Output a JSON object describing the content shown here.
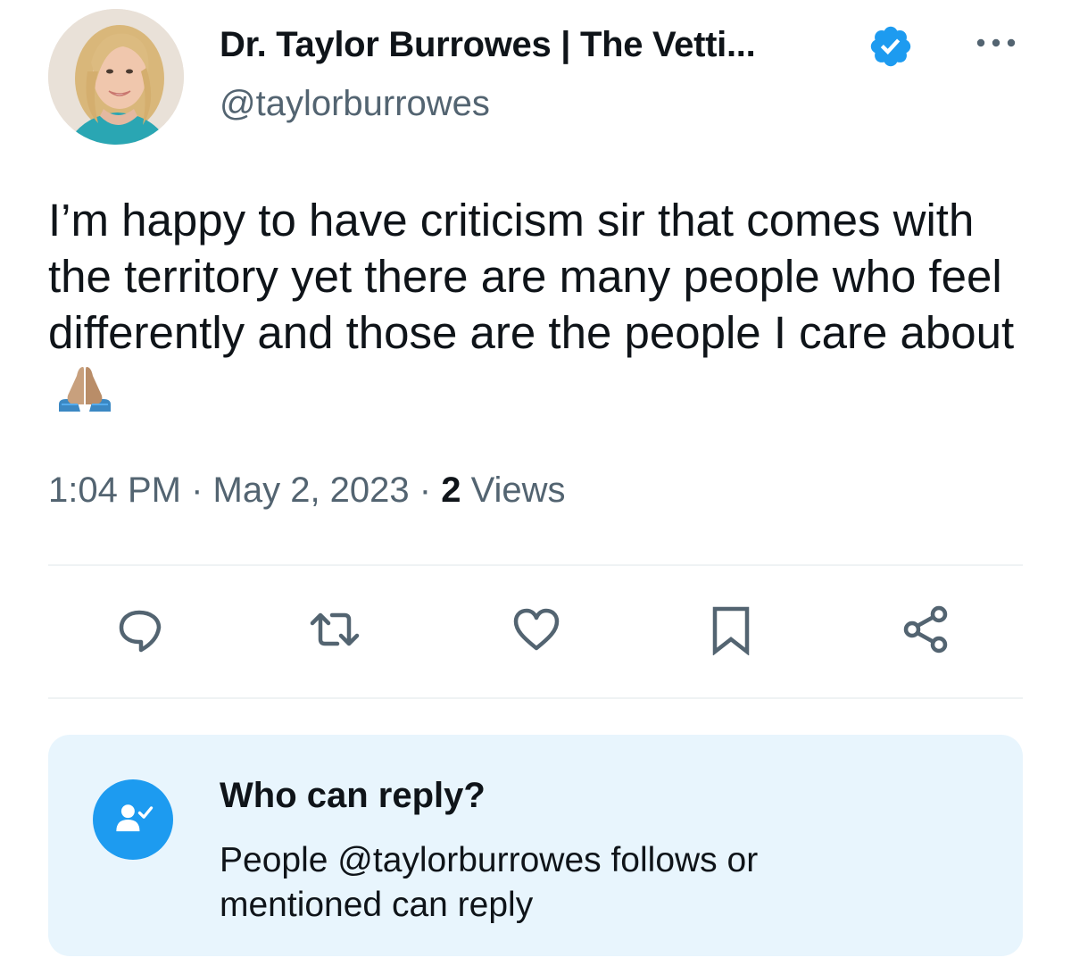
{
  "author": {
    "display_name": "Dr. Taylor Burrowes | The Vetti...",
    "handle": "@taylorburrowes",
    "verified": true,
    "avatar_icon": "profile-photo"
  },
  "tweet": {
    "text": "I’m happy to have criticism sir that comes with the territory yet there are many people who feel differently and those are the people I care about",
    "emoji_icon": "folded-hands-emoji",
    "time": "1:04 PM",
    "separator": " · ",
    "date": "May 2, 2023",
    "views_count": "2",
    "views_label": " Views"
  },
  "actions": [
    {
      "name": "reply",
      "icon": "comment-icon"
    },
    {
      "name": "retweet",
      "icon": "retweet-icon"
    },
    {
      "name": "like",
      "icon": "heart-icon"
    },
    {
      "name": "bookmark",
      "icon": "bookmark-icon"
    },
    {
      "name": "share",
      "icon": "share-icon"
    }
  ],
  "reply_settings": {
    "title": "Who can reply?",
    "description": "People @taylorburrowes follows or mentioned can reply",
    "icon": "person-check-icon"
  },
  "colors": {
    "accent": "#1d9bf0",
    "secondary_text": "#536471",
    "icon_gray": "#536471",
    "reply_box_bg": "#e8f5fd"
  }
}
